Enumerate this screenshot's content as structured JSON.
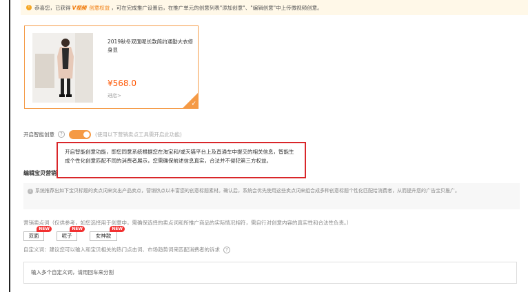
{
  "notice": {
    "prefix": "恭喜您，已获得",
    "logo": "V视频",
    "link": "创意权益",
    "suffix": "，可在完成推广设置后，在推广单元的创意列表\"添加创意\"、\"编辑创意\"中上传微视频创意。"
  },
  "product": {
    "title": "2019秋冬双面呢长款简约通勤大衣修身显",
    "price": "¥568.0",
    "shop_link": "进店>"
  },
  "smart_creative": {
    "label": "开启智能创意",
    "enabled": true,
    "hint": "(使用以下营销卖点工具需开启此功能)",
    "tooltip": "开启智能创意功能，即您同意系统根据您在淘宝和/或天猫平台上及直通车中提交的相关信息，智能生成个性化创意匹配不同的消费者展示，您需确保前述信息真实，合法并不侵犯第三方权益。"
  },
  "section": {
    "title": "编辑宝贝营销卖点"
  },
  "info": {
    "text": "系统推荐出如下宝贝标题的卖点词来突出产品卖点，营销热点以丰富您的创意标题素材。确认后，系统会优先使用这些卖点词来组合成多种创意标题个性化匹配给消费者，从而提升您的广告宝贝推广。"
  },
  "selling_points": {
    "label": "营销卖点词（仅供参考，如您选择用于创意中，需确保选择的卖点词和所推广商品的实际情况相符，需自行对创意内容的真实性和合法性负责。）",
    "tags": [
      {
        "label": "双面",
        "badge": "NEW"
      },
      {
        "label": "呢子",
        "badge": "NEW"
      },
      {
        "label": "女神款",
        "badge": "NEW"
      }
    ]
  },
  "custom": {
    "label": "自定义词：建议您可以输入和宝贝相关的热门点击词、市场趋势词来匹配消费者的诉求",
    "placeholder": "输入多个自定义词，请用回车来分割"
  },
  "colors": {
    "accent": "#f59a45",
    "price": "#ff5500",
    "tooltip_border": "#d9262a",
    "badge": "#f23030"
  }
}
